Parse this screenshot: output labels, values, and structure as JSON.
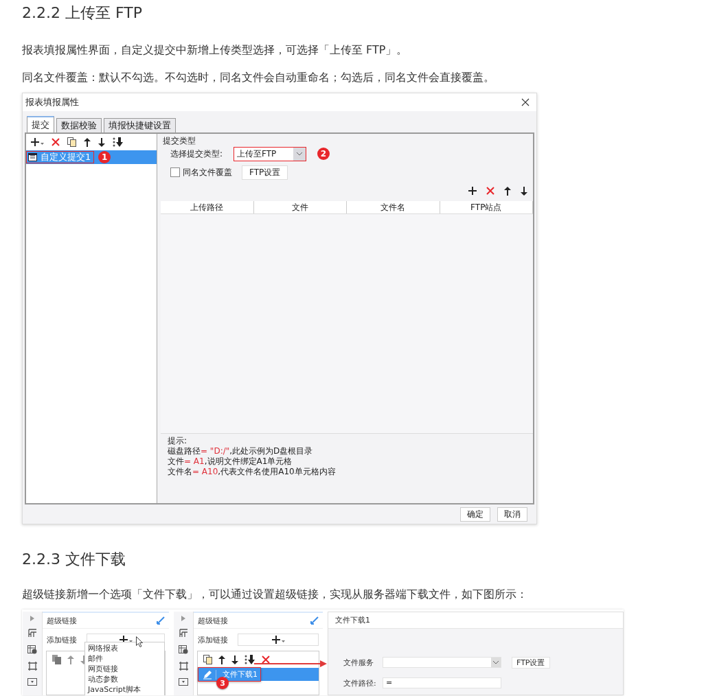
{
  "heading_1": "2.2.2 上传至 FTP",
  "paragraphs_1": [
    "报表填报属性界面，自定义提交中新增上传类型选择，可选择「上传至 FTP」。",
    "同名文件覆盖：默认不勾选。不勾选时，同名文件会自动重命名；勾选后，同名文件会直接覆盖。"
  ],
  "dialog": {
    "title": "报表填报属性",
    "tabs": [
      {
        "label": "提交",
        "selected": true
      },
      {
        "label": "数据校验",
        "selected": false
      },
      {
        "label": "填报快捷键设置",
        "selected": false
      }
    ],
    "tree": [
      {
        "label": "自定义提交1",
        "selected": true,
        "callout": "1"
      }
    ],
    "group_title": "提交类型",
    "type_field": {
      "label": "选择提交类型:",
      "value": "上传至FTP",
      "callout": "2"
    },
    "overwrite": {
      "label": "同名文件覆盖",
      "checked": false
    },
    "ftp_button": "FTP设置",
    "columns": [
      "上传路径",
      "文件",
      "文件名",
      "FTP站点"
    ],
    "hint": {
      "title": "提示:",
      "lines": [
        {
          "segments": [
            {
              "kind": "text",
              "text": "磁盘路径"
            },
            {
              "kind": "code",
              "text": "= \"D:/\""
            },
            {
              "kind": "text",
              "text": ",此处示例为D盘根目录"
            }
          ]
        },
        {
          "segments": [
            {
              "kind": "text",
              "text": "文件"
            },
            {
              "kind": "code",
              "text": "= A1"
            },
            {
              "kind": "text",
              "text": ",说明文件绑定A1单元格"
            }
          ]
        },
        {
          "segments": [
            {
              "kind": "text",
              "text": "文件名"
            },
            {
              "kind": "code",
              "text": "= A10"
            },
            {
              "kind": "text",
              "text": ",代表文件名使用A10单元格内容"
            }
          ]
        }
      ]
    },
    "buttons": [
      "确定",
      "取消"
    ]
  },
  "heading_2": "2.2.3 文件下载",
  "paragraph_2": "超级链接新增一个选项「文件下载」，可以通过设置超级链接，实现从服务器端下载文件，如下图所示：",
  "hyperlink_shot": {
    "panel_a": {
      "title": "超级链接",
      "add_label": "添加链接",
      "menu": [
        "网络报表",
        "邮件",
        "网页链接",
        "动态参数",
        "JavaScript脚本"
      ]
    },
    "panel_b": {
      "title": "超级链接",
      "add_label": "添加链接",
      "items": [
        {
          "label": "文件下载1",
          "selected": true,
          "callout": "3"
        }
      ]
    },
    "detail": {
      "title": "文件下载1",
      "fields": [
        {
          "kind": "select",
          "label": "文件服务",
          "button": "FTP设置"
        },
        {
          "kind": "input",
          "label": "文件路径:",
          "value": "="
        }
      ]
    }
  }
}
